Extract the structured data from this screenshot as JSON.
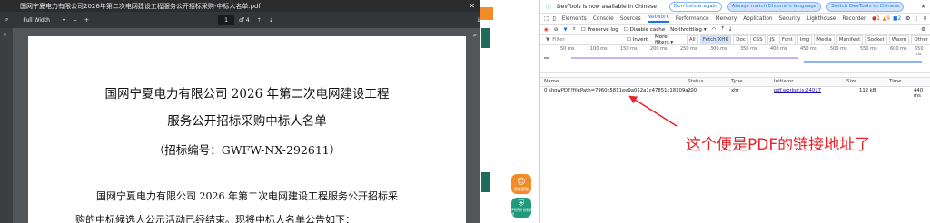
{
  "pdf": {
    "window_title": "国网宁夏电力有限公司2026年第二次电网建设工程服务公开招标采购-中标人名单.pdf",
    "zoom_label": "Full Width",
    "page_current": "1",
    "page_total": "of 4",
    "doc_title_line1": "国网宁夏电力有限公司 2026 年第二次电网建设工程",
    "doc_title_line2": "服务公开招标采购中标人名单",
    "doc_code": "（招标编号：GWFW-NX-292611）",
    "doc_body_line1": "国网宁夏电力有限公司 2026 年第二次电网建设工程服务公开招标采",
    "doc_body_line2": "购的中标候选人公示活动已经结束。现将中标人名单公告如下："
  },
  "site_badges": {
    "badge1": "智能客服",
    "badge2": "严管严管 线索举报"
  },
  "devtools": {
    "banner_text": "DevTools is now available in Chinese",
    "btn_dont_show": "Don't show again",
    "btn_always_match": "Always match Chrome's language",
    "btn_switch": "Switch DevTools to Chinese",
    "tabs": [
      "Elements",
      "Console",
      "Sources",
      "Network",
      "Performance",
      "Memory",
      "Application",
      "Security",
      "Lighthouse",
      "Recorder"
    ],
    "toolbar": {
      "preserve_log": "Preserve log",
      "disable_cache": "Disable cache",
      "throttling": "No throttling"
    },
    "filter_placeholder": "Filter",
    "invert": "Invert",
    "more_filters": "More filters ▾",
    "type_filters": [
      "All",
      "Fetch/XHR",
      "Doc",
      "CSS",
      "JS",
      "Font",
      "Img",
      "Media",
      "Manifest",
      "Socket",
      "Wasm",
      "Other"
    ],
    "timeline_ticks": [
      "50 ms",
      "100 ms",
      "150 ms",
      "200 ms",
      "250 ms",
      "300 ms",
      "350 ms",
      "400 ms",
      "450 ms",
      "500 ms",
      "550 ms",
      "600 ms",
      "650 ms"
    ],
    "columns": {
      "name": "Name",
      "status": "Status",
      "type": "Type",
      "initiator": "Initiator",
      "size": "Size",
      "time": "Time"
    },
    "row": {
      "name": "0 showPDF?filePath=7960c5811ee9a052a1c47851c18109a...",
      "status": "200",
      "type": "xhr",
      "initiator": "pdf.worker.js:24017",
      "size": "112 kB",
      "time": "440 ms"
    },
    "errors": "1",
    "warnings": "9",
    "issues": "2"
  },
  "annotation": {
    "text": "这个便是PDF的链接地址了"
  },
  "colors": {
    "accent": "#1a73e8",
    "annotation": "#e8232a",
    "site_green": "#0d5c4d",
    "site_orange": "#f28c28"
  }
}
